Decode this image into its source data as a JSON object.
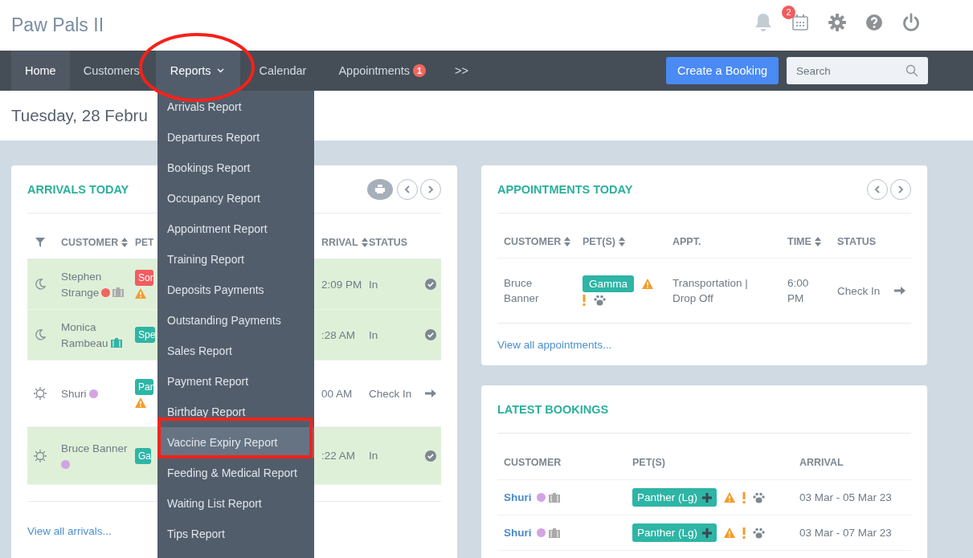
{
  "app": {
    "title": "Paw Pals II",
    "calendar_badge": "2"
  },
  "nav": {
    "items": [
      {
        "label": "Home",
        "selected": true,
        "kind": "link"
      },
      {
        "label": "Customers",
        "selected": false,
        "kind": "link"
      },
      {
        "label": "Reports",
        "selected": false,
        "kind": "dropdown",
        "expanded": true
      },
      {
        "label": "Calendar",
        "selected": false,
        "kind": "link"
      },
      {
        "label": "Appointments",
        "selected": false,
        "kind": "link",
        "badge": "1"
      },
      {
        "label": ">>",
        "selected": false,
        "kind": "link"
      }
    ],
    "create_button": "Create a Booking",
    "search": {
      "placeholder": "Search"
    }
  },
  "date_heading": "Tuesday, 28 Febru",
  "reports_menu": {
    "items": [
      {
        "label": "Arrivals Report",
        "selected": false
      },
      {
        "label": "Departures Report",
        "selected": false
      },
      {
        "label": "Bookings Report",
        "selected": false
      },
      {
        "label": "Occupancy Report",
        "selected": false
      },
      {
        "label": "Appointment Report",
        "selected": false
      },
      {
        "label": "Training Report",
        "selected": false
      },
      {
        "label": "Deposits Payments",
        "selected": false
      },
      {
        "label": "Outstanding Payments",
        "selected": false
      },
      {
        "label": "Sales Report",
        "selected": false
      },
      {
        "label": "Payment Report",
        "selected": false
      },
      {
        "label": "Birthday Report",
        "selected": false
      },
      {
        "label": "Vaccine Expiry Report",
        "selected": true
      },
      {
        "label": "Feeding & Medical Report",
        "selected": false
      },
      {
        "label": "Waiting List Report",
        "selected": false
      },
      {
        "label": "Tips Report",
        "selected": false
      }
    ]
  },
  "arrivals": {
    "title": "ARRIVALS TODAY",
    "columns": [
      {
        "label": "CUSTOMER",
        "sortable": true
      },
      {
        "label": "PET",
        "sortable": false
      },
      {
        "label": "RRIVAL",
        "sortable": true
      },
      {
        "label": "STATUS",
        "sortable": false
      }
    ],
    "rows": [
      {
        "overnight": true,
        "highlighted": true,
        "customer": "Stephen Strange",
        "markers": [
          {
            "kind": "dot",
            "color": "#f0675f"
          },
          {
            "kind": "suitcase",
            "color": "#aaaaaa"
          }
        ],
        "pet": {
          "name": "Sor",
          "color": "#f25c62"
        },
        "warning": true,
        "arrival": "2:09 PM",
        "status": "In",
        "checked_in": true
      },
      {
        "overnight": true,
        "highlighted": true,
        "customer": "Monica Rambeau",
        "markers": [
          {
            "kind": "suitcase",
            "color": "#2eb5a5"
          }
        ],
        "pet": {
          "name": "Spe",
          "color": "#2eb5a5"
        },
        "warning": false,
        "arrival": ":28 AM",
        "status": "In",
        "checked_in": true
      },
      {
        "overnight": false,
        "highlighted": false,
        "customer": "Shuri",
        "markers": [
          {
            "kind": "dot",
            "color": "#d3a3e6"
          }
        ],
        "pet": {
          "name": "Par",
          "color": "#2eb5a5"
        },
        "warning": true,
        "arrival": "00 AM",
        "status": "Check In",
        "checked_in": false
      },
      {
        "overnight": false,
        "highlighted": true,
        "customer": "Bruce Banner",
        "markers": [
          {
            "kind": "dot",
            "color": "#d3a3e6"
          }
        ],
        "pet": {
          "name": "Ga",
          "color": "#2eb5a5"
        },
        "warning": false,
        "arrival": ":22 AM",
        "status": "In",
        "checked_in": true
      }
    ],
    "link": "View all arrivals..."
  },
  "appointments": {
    "title": "APPOINTMENTS TODAY",
    "columns": [
      {
        "label": "CUSTOMER",
        "sortable": true
      },
      {
        "label": "PET(S)",
        "sortable": true
      },
      {
        "label": "APPT.",
        "sortable": false
      },
      {
        "label": "TIME",
        "sortable": true
      },
      {
        "label": "STATUS",
        "sortable": false
      }
    ],
    "rows": [
      {
        "customer": "Bruce Banner",
        "pet": "Gamma",
        "flags": [
          {
            "kind": "warning"
          },
          {
            "kind": "alert"
          },
          {
            "kind": "paw"
          }
        ],
        "appointment": "Transportation | Drop Off",
        "time": "6:00 PM",
        "status": "Check In"
      }
    ],
    "link": "View all appointments..."
  },
  "latest_bookings": {
    "title": "LATEST BOOKINGS",
    "columns": [
      "CUSTOMER",
      "PET(S)",
      "ARRIVAL"
    ],
    "rows": [
      {
        "customer": "Shuri",
        "markers": [
          {
            "kind": "dot",
            "color": "#d3a3e6"
          },
          {
            "kind": "suitcase",
            "color": "#aaaaaa"
          }
        ],
        "pet": "Panther (Lg)",
        "flags": [
          {
            "kind": "warning"
          },
          {
            "kind": "alert"
          },
          {
            "kind": "paw"
          }
        ],
        "arrival": "03 Mar - 05 Mar 23"
      },
      {
        "customer": "Shuri",
        "markers": [
          {
            "kind": "dot",
            "color": "#d3a3e6"
          },
          {
            "kind": "suitcase",
            "color": "#aaaaaa"
          }
        ],
        "pet": "Panther (Lg)",
        "flags": [
          {
            "kind": "warning"
          },
          {
            "kind": "alert"
          },
          {
            "kind": "paw"
          }
        ],
        "arrival": "03 Mar - 07 Mar 23"
      }
    ]
  }
}
